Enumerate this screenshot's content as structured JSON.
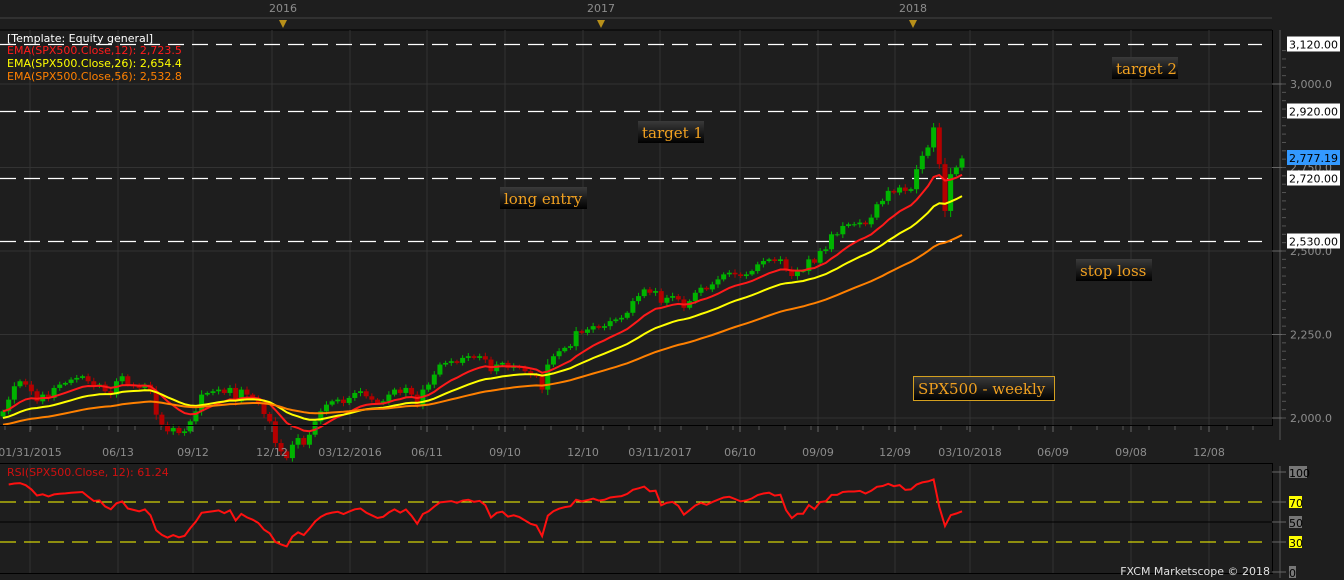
{
  "chart_data": {
    "type": "candlestick",
    "title": "SPX500 - weekly",
    "template_label": "[Template: Equity general]",
    "legend": [
      {
        "label": "EMA(SPX500.Close,12): 2,723.5",
        "period": 12,
        "color": "#ff1a1a"
      },
      {
        "label": "EMA(SPX500.Close,26): 2,654.4",
        "period": 26,
        "color": "#ffff00"
      },
      {
        "label": "EMA(SPX500.Close,56): 2,532.8",
        "period": 56,
        "color": "#ff8000"
      }
    ],
    "ylim": [
      2000,
      3120
    ],
    "y_ticks": [
      "2,000.0",
      "2,250.0",
      "2,500.0",
      "2,750.0",
      "3,000.0"
    ],
    "y_tick_values": [
      2000,
      2250,
      2500,
      2750,
      3000
    ],
    "x_tick_labels": [
      "01/31/2015",
      "06/13",
      "09/12",
      "12/12",
      "03/12/2016",
      "06/11",
      "09/10",
      "12/10",
      "03/11/2017",
      "06/10",
      "09/09",
      "12/09",
      "03/10/2018",
      "06/09",
      "09/08",
      "12/08"
    ],
    "year_labels": [
      "2016",
      "2017",
      "2018"
    ],
    "levels": [
      {
        "value": 3120,
        "label": "3,120.00"
      },
      {
        "value": 2920,
        "label": "2,920.00"
      },
      {
        "value": 2720,
        "label": "2,720.00"
      },
      {
        "value": 2530,
        "label": "2,530.00"
      }
    ],
    "last_price": {
      "value": 2777.19,
      "label": "2,777.19",
      "color": "#3399ff"
    },
    "annotations": [
      "target 2",
      "target 1",
      "long entry",
      "stop loss"
    ],
    "up_color": "#00b400",
    "down_color": "#b40000",
    "weekly_close": [
      2020,
      2055,
      2095,
      2110,
      2100,
      2080,
      2050,
      2070,
      2060,
      2090,
      2100,
      2105,
      2115,
      2120,
      2125,
      2110,
      2095,
      2100,
      2080,
      2070,
      2110,
      2125,
      2100,
      2095,
      2090,
      2100,
      2080,
      2010,
      1980,
      1960,
      1970,
      1955,
      1960,
      1990,
      2020,
      2070,
      2075,
      2080,
      2085,
      2075,
      2090,
      2050,
      2085,
      2070,
      2060,
      2045,
      2012,
      1990,
      1925,
      1900,
      1880,
      1920,
      1940,
      1920,
      1950,
      1990,
      2020,
      2040,
      2050,
      2055,
      2045,
      2060,
      2075,
      2080,
      2065,
      2055,
      2045,
      2050,
      2070,
      2085,
      2075,
      2090,
      2070,
      2040,
      2085,
      2100,
      2130,
      2160,
      2165,
      2170,
      2165,
      2180,
      2185,
      2180,
      2185,
      2175,
      2140,
      2160,
      2165,
      2150,
      2155,
      2150,
      2140,
      2130,
      2125,
      2085,
      2160,
      2185,
      2200,
      2210,
      2215,
      2260,
      2255,
      2265,
      2275,
      2270,
      2275,
      2290,
      2295,
      2300,
      2315,
      2350,
      2365,
      2385,
      2375,
      2380,
      2345,
      2360,
      2365,
      2355,
      2330,
      2350,
      2375,
      2390,
      2385,
      2400,
      2415,
      2430,
      2435,
      2430,
      2425,
      2430,
      2440,
      2460,
      2470,
      2475,
      2470,
      2475,
      2445,
      2425,
      2440,
      2440,
      2475,
      2465,
      2500,
      2505,
      2550,
      2550,
      2575,
      2580,
      2580,
      2585,
      2580,
      2600,
      2640,
      2650,
      2680,
      2675,
      2690,
      2680,
      2685,
      2745,
      2785,
      2810,
      2870,
      2760,
      2620,
      2730,
      2750,
      2777.19
    ],
    "rsi": {
      "label": "RSI(SPX500.Close, 12): 61.24",
      "period": 12,
      "ylim": [
        0,
        100
      ],
      "levels": [
        30,
        70
      ],
      "y_ticks": [
        "0",
        "30",
        "50",
        "70",
        "100"
      ],
      "y_tick_values": [
        0,
        30,
        50,
        70,
        100
      ]
    }
  },
  "footer": "FXCM Marketscope © 2018"
}
